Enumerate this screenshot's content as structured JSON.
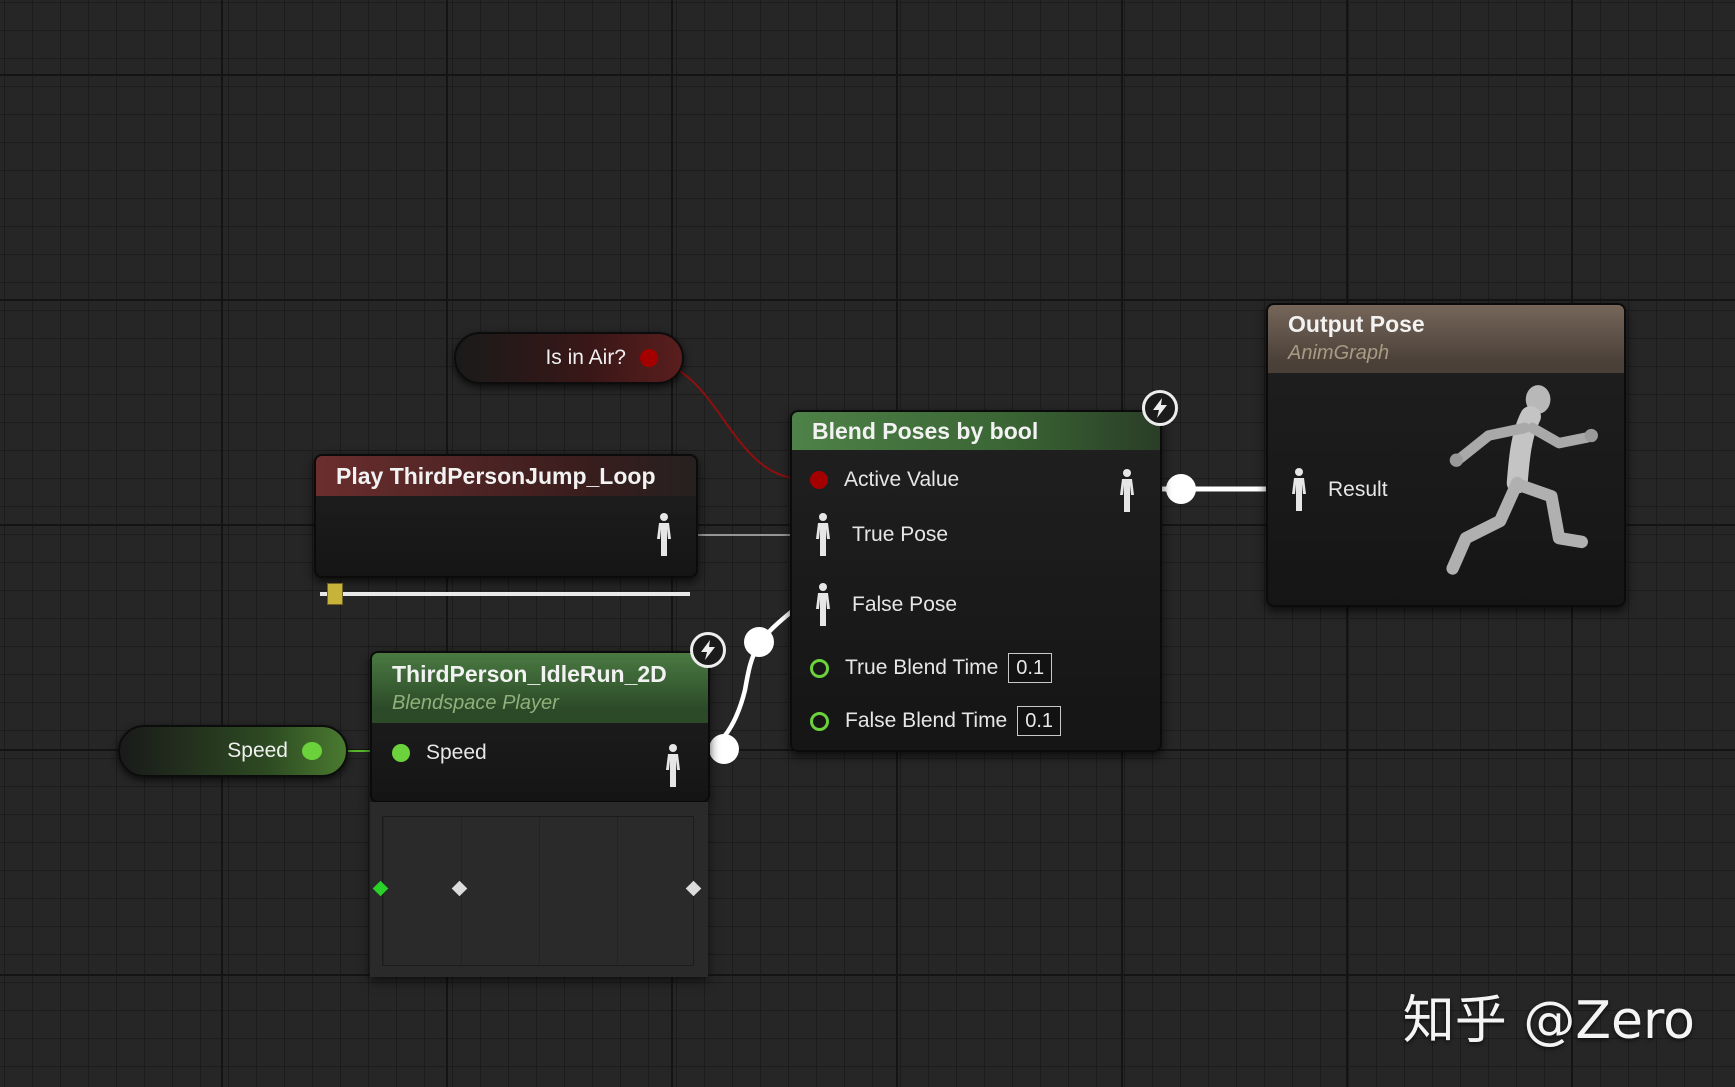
{
  "colors": {
    "background": "#262626",
    "bool_pin": "#a50000",
    "float_pin": "#6bd23b",
    "blend_header": "#3f6b3a",
    "jump_header": "#5c2a2a",
    "output_header": "#6a5a4a",
    "wire_exec": "#ffffff"
  },
  "graph": {
    "getter_is_in_air": {
      "label": "Is in Air?",
      "pin_icon": "bool-pin-icon"
    },
    "getter_speed": {
      "label": "Speed",
      "pin_icon": "float-pin-icon"
    },
    "play_jump": {
      "title": "Play ThirdPersonJump_Loop",
      "output_icon": "pose-pin-icon",
      "progress": 0.02
    },
    "blendspace": {
      "title": "ThirdPerson_IdleRun_2D",
      "subtitle": "Blendspace Player",
      "input_label": "Speed",
      "output_icon": "pose-pin-icon",
      "fast_path_icon": "lightning-icon"
    },
    "blend_poses": {
      "title": "Blend Poses by bool",
      "fast_path_icon": "lightning-icon",
      "pins": {
        "active_value": "Active Value",
        "true_pose": "True Pose",
        "false_pose": "False Pose",
        "true_blend_time": "True Blend Time",
        "false_blend_time": "False Blend Time"
      },
      "true_blend_value": "0.1",
      "false_blend_value": "0.1"
    },
    "output_pose": {
      "title": "Output Pose",
      "subtitle": "AnimGraph",
      "result_label": "Result",
      "preview_icon": "running-mannequin-icon"
    }
  },
  "watermark": "知乎 @Zero"
}
